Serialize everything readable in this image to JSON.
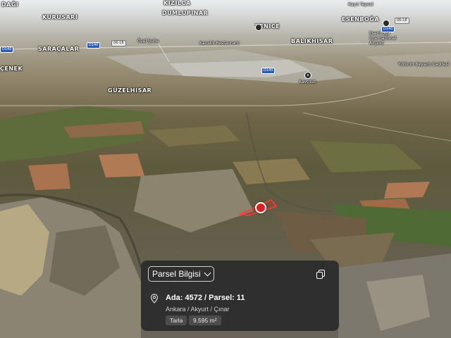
{
  "map": {
    "place_labels": [
      {
        "text": "DAĞI",
        "name": "label-dagi"
      },
      {
        "text": "KIZILCA",
        "name": "label-kizilca"
      },
      {
        "text": "Kayıt Tepesi",
        "name": "label-kayit-tepesi"
      },
      {
        "text": "KURUSARI",
        "name": "label-kurusari"
      },
      {
        "text": "DUMLUPINAR",
        "name": "label-dumlupinar"
      },
      {
        "text": "YENICE",
        "name": "label-yenice"
      },
      {
        "text": "ESENBOĞA",
        "name": "label-esenboga"
      },
      {
        "text": "SARAÇALAR",
        "name": "label-saracalar"
      },
      {
        "text": "BALIKHISAR",
        "name": "label-balikhisar"
      },
      {
        "text": "ÇENEK",
        "name": "label-cenek"
      },
      {
        "text": "GÜZELHISAR",
        "name": "label-guzelhisar"
      }
    ],
    "poi_labels": [
      {
        "text": "Özel Şube",
        "name": "label-ozel-sube"
      },
      {
        "text": "Kavaklı Restaurant",
        "name": "label-kavakli-restaurant"
      },
      {
        "text": "Esenboğa International Airport",
        "name": "label-esenboga-airport"
      },
      {
        "text": "KavClub",
        "name": "label-kavclub"
      },
      {
        "text": "Yıldırım Beyazıt Caddesi",
        "name": "label-yildirim-beyazit-caddesi"
      }
    ],
    "road_shields": [
      "D140",
      "D140",
      "D140",
      "06-18",
      "06-18",
      "D140"
    ]
  },
  "panel": {
    "dropdown_label": "Parsel Bilgisi",
    "title": "Ada: 4572 / Parsel: 11",
    "address": "Ankara / Akyurt / Çınar",
    "chips": [
      "Tarla",
      "9.595 m²"
    ]
  },
  "colors": {
    "marker": "#e02020",
    "parcel": "#e02020",
    "panel_bg": "#28282a"
  }
}
